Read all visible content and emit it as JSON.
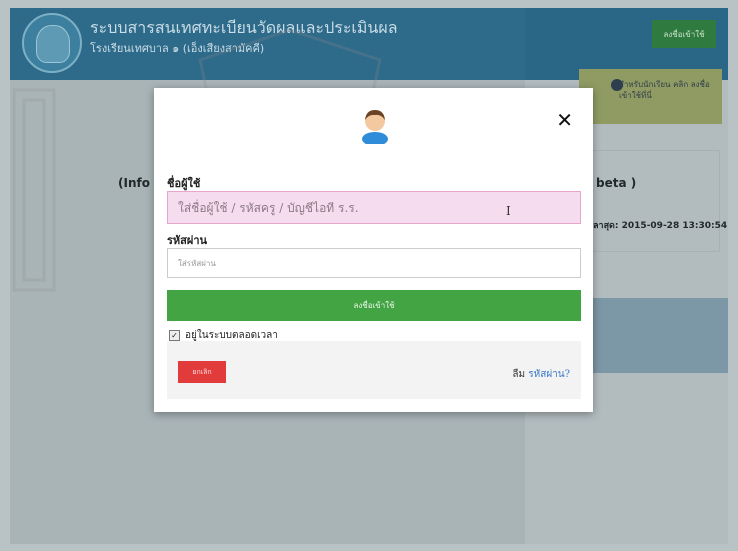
{
  "header": {
    "title": "ระบบสารสนเทศทะเบียนวัดผลและประเมินผล",
    "subtitle": "โรงเรียนเทศบาล ๑ (เอ็งเสียงสามัคคี)",
    "login_button": "ลงชื่อเข้าใช้"
  },
  "side": {
    "student_panel": "สำหรับนักเรียน คลิก ลงชื่อเข้าใช้ที่นี่",
    "info_right": "beta )",
    "update_label": "ลาสุด: 2015-09-28 13:30:54"
  },
  "main": {
    "info_left": "(Info"
  },
  "modal": {
    "username_label": "ชื่อผู้ใช้",
    "username_placeholder": "ใส่ชื่อผู้ใช้ / รหัสครู / บัญชีไอที ร.ร.",
    "password_label": "รหัสผ่าน",
    "password_placeholder": "ใส่รหัสผ่าน",
    "submit_label": "ลงชื่อเข้าใช้",
    "remember_label": "อยู่ในระบบตลอดเวลา",
    "cancel_label": "ยกเลิก",
    "forgot_prefix": "ลืม",
    "forgot_link": "รหัสผ่าน?",
    "close_symbol": "✕"
  },
  "colors": {
    "header": "#2e6a8a",
    "submit": "#43a443",
    "cancel": "#e23b3b",
    "username_field": "#f6dcef"
  }
}
